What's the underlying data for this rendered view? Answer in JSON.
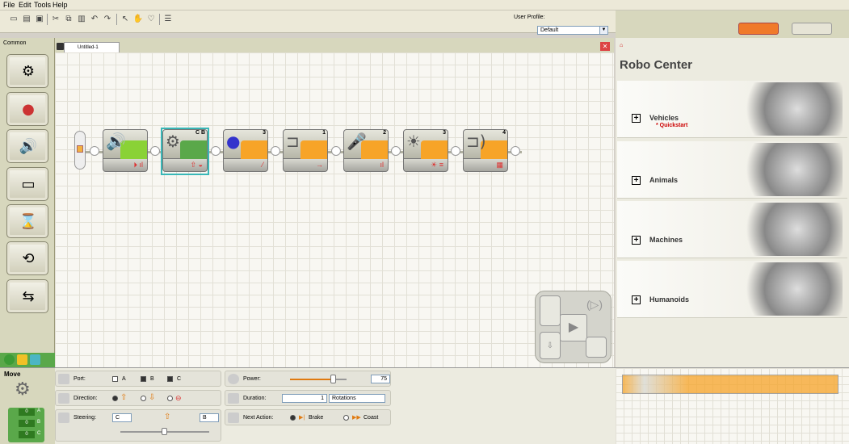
{
  "menu": {
    "file": "File",
    "edit": "Edit",
    "tools": "Tools",
    "help": "Help"
  },
  "toolbar": {
    "user_profile_label": "User Profile:",
    "user_profile_value": "Default"
  },
  "palette": {
    "tab": "Common"
  },
  "canvas": {
    "tab_title": "Untitled-1",
    "blocks": [
      {
        "num": ""
      },
      {
        "num": "C B"
      },
      {
        "num": "3"
      },
      {
        "num": "1"
      },
      {
        "num": "2"
      },
      {
        "num": "3"
      },
      {
        "num": "4"
      }
    ]
  },
  "robo_center": {
    "title": "Robo Center",
    "items": [
      {
        "label": "Vehicles",
        "sub": "* Quickstart"
      },
      {
        "label": "Animals",
        "sub": ""
      },
      {
        "label": "Machines",
        "sub": ""
      },
      {
        "label": "Humanoids",
        "sub": ""
      }
    ]
  },
  "config": {
    "block_name": "Move",
    "slots": [
      "0",
      "0",
      "0"
    ],
    "slot_letters": [
      "A",
      "B",
      "C"
    ],
    "port_label": "Port:",
    "ports": [
      "A",
      "B",
      "C"
    ],
    "direction_label": "Direction:",
    "steering_label": "Steering:",
    "steering_left": "C",
    "steering_right": "B",
    "power_label": "Power:",
    "power_value": "75",
    "power_fraction": 0.75,
    "duration_label": "Duration:",
    "duration_value": "1",
    "duration_unit": "Rotations",
    "next_action_label": "Next Action:",
    "brake_label": "Brake",
    "coast_label": "Coast"
  },
  "colors": {
    "block_orange": "#f7a428",
    "palette_green": "#5aa84a",
    "canvas_bg": "#f8f7f2"
  }
}
